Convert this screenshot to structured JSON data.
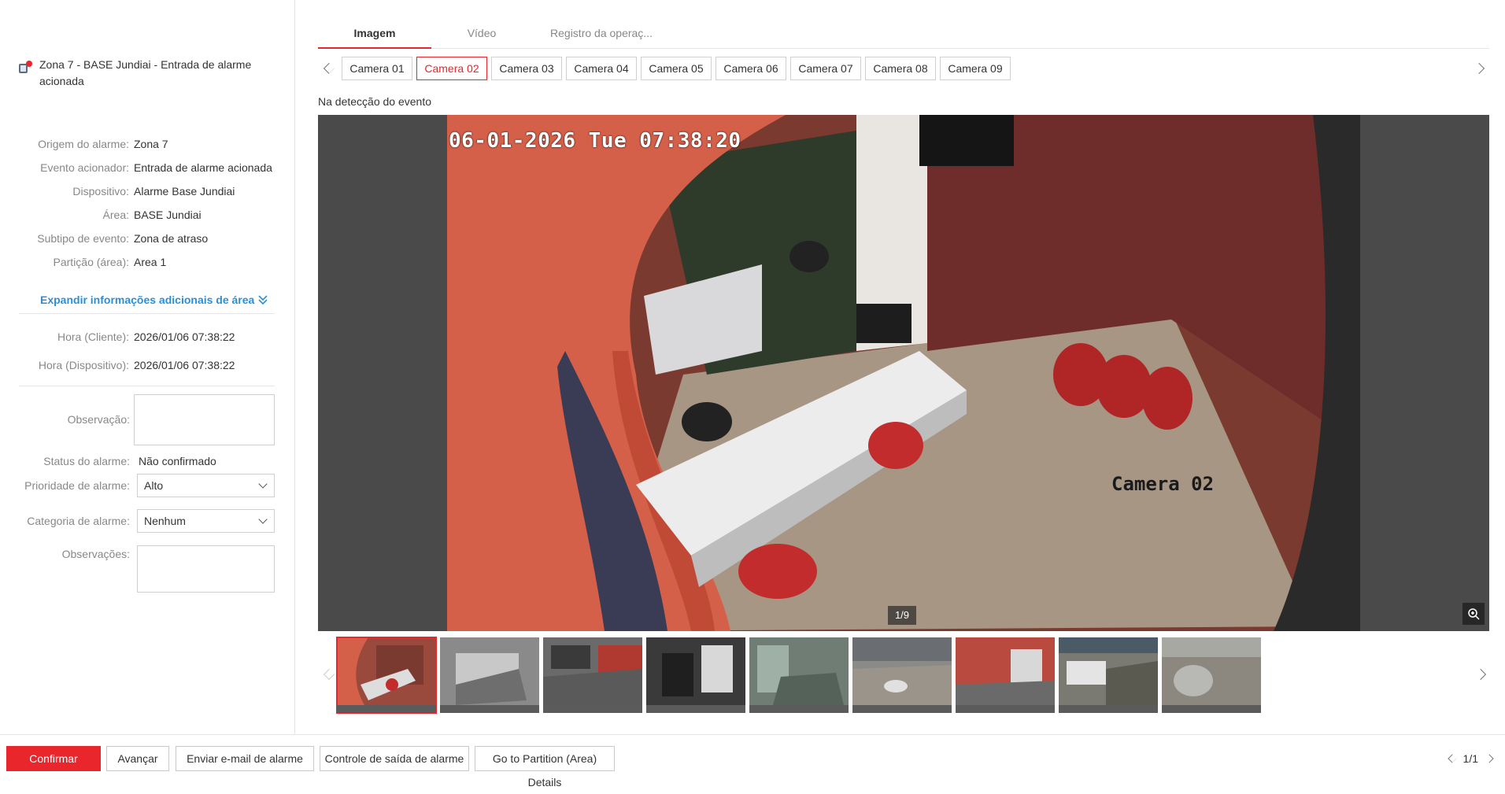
{
  "alarm": {
    "title": "Zona 7 - BASE Jundiai - Entrada de alarme acionada",
    "icon": "alarm-device-icon"
  },
  "details": [
    {
      "label": "Origem do alarme:",
      "value": "Zona 7"
    },
    {
      "label": "Evento acionador:",
      "value": "Entrada de alarme acionada"
    },
    {
      "label": "Dispositivo:",
      "value": "Alarme Base Jundiai"
    },
    {
      "label": "Área:",
      "value": "BASE Jundiai"
    },
    {
      "label": "Subtipo de evento:",
      "value": "Zona de atraso"
    },
    {
      "label": "Partição (área):",
      "value": "Area 1"
    }
  ],
  "expand_label": "Expandir informações adicionais de área",
  "times": [
    {
      "label": "Hora (Cliente):",
      "value": "2026/01/06 07:38:22"
    },
    {
      "label": "Hora (Dispositivo):",
      "value": "2026/01/06 07:38:22"
    }
  ],
  "form": {
    "observacao_label": "Observação:",
    "status_label": "Status do alarme:",
    "status_value": "Não confirmado",
    "prioridade_label": "Prioridade de alarme:",
    "prioridade_value": "Alto",
    "categoria_label": "Categoria de alarme:",
    "categoria_value": "Nenhum",
    "observacoes_label": "Observações:"
  },
  "tabs": [
    "Imagem",
    "Vídeo",
    "Registro da operaç..."
  ],
  "active_tab": "Imagem",
  "cameras": [
    "Camera 01",
    "Camera 02",
    "Camera 03",
    "Camera 04",
    "Camera 05",
    "Camera 06",
    "Camera 07",
    "Camera 08",
    "Camera 09"
  ],
  "active_camera": "Camera 02",
  "detect_label": "Na detecção do evento",
  "viewer": {
    "osd_time": "06-01-2026 Tue 07:38:20",
    "osd_camera": "Camera 02",
    "counter": "1/9"
  },
  "footer": {
    "confirm": "Confirmar",
    "next": "Avançar",
    "email": "Enviar e-mail de alarme",
    "output": "Controle de saída de alarme",
    "partition": "Go to Partition (Area) Details",
    "pager": "1/1"
  },
  "colors": {
    "accent": "#e8262c",
    "link": "#2b8fd6"
  }
}
